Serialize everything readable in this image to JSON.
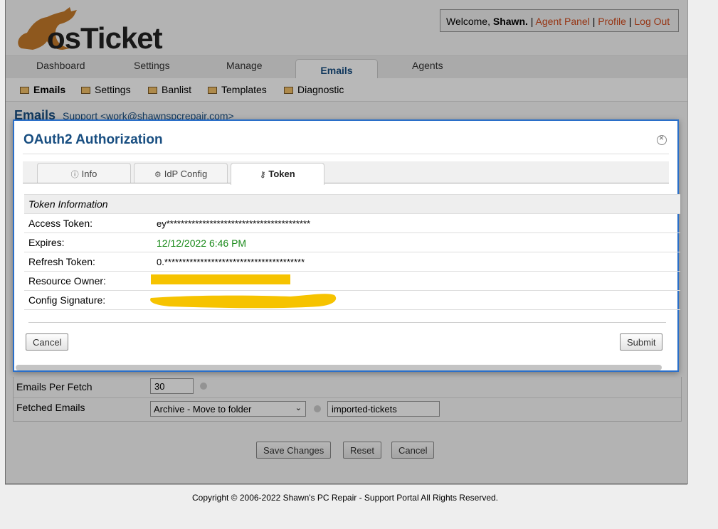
{
  "header": {
    "logo_text": "osTicket",
    "welcome_prefix": "Welcome, ",
    "user_name": "Shawn.",
    "links": [
      "Agent Panel",
      "Profile",
      "Log Out"
    ],
    "sep": "|"
  },
  "nav": {
    "tabs": [
      "Dashboard",
      "Settings",
      "Manage",
      "Emails",
      "Agents"
    ],
    "active": "Emails"
  },
  "subnav": {
    "items": [
      "Emails",
      "Settings",
      "Banlist",
      "Templates",
      "Diagnostic"
    ],
    "active": "Emails"
  },
  "page": {
    "heading": "Emails",
    "heading_sub": "Support <work@shawnspcrepair.com>"
  },
  "form": {
    "emails_per_fetch_label": "Emails Per Fetch",
    "emails_per_fetch_value": "30",
    "fetched_emails_label": "Fetched Emails",
    "fetched_emails_selected": "Archive - Move to folder",
    "folder_value": "imported-tickets",
    "buttons": {
      "save": "Save Changes",
      "reset": "Reset",
      "cancel": "Cancel"
    }
  },
  "footer": "Copyright © 2006-2022 Shawn's PC Repair - Support Portal All Rights Reserved.",
  "dialog": {
    "title": "OAuth2 Authorization",
    "tabs": [
      {
        "label": "Info",
        "icon": "info-icon"
      },
      {
        "label": "IdP Config",
        "icon": "gear-icon"
      },
      {
        "label": "Token",
        "icon": "key-icon"
      }
    ],
    "active_tab": "Token",
    "section_title": "Token Information",
    "rows": [
      {
        "label": "Access Token:",
        "value": "ey****************************************"
      },
      {
        "label": "Expires:",
        "value": "12/12/2022 6:46 PM"
      },
      {
        "label": "Refresh Token:",
        "value": "0.***************************************"
      },
      {
        "label": "Resource Owner:",
        "value": ""
      },
      {
        "label": "Config Signature:",
        "value": ""
      }
    ],
    "cancel": "Cancel",
    "submit": "Submit"
  },
  "colors": {
    "link": "#d04a1c",
    "title_blue": "#184e81",
    "dialog_border": "#2a6fc9",
    "expires_green": "#1a8a1a",
    "redaction": "#f6c300"
  }
}
